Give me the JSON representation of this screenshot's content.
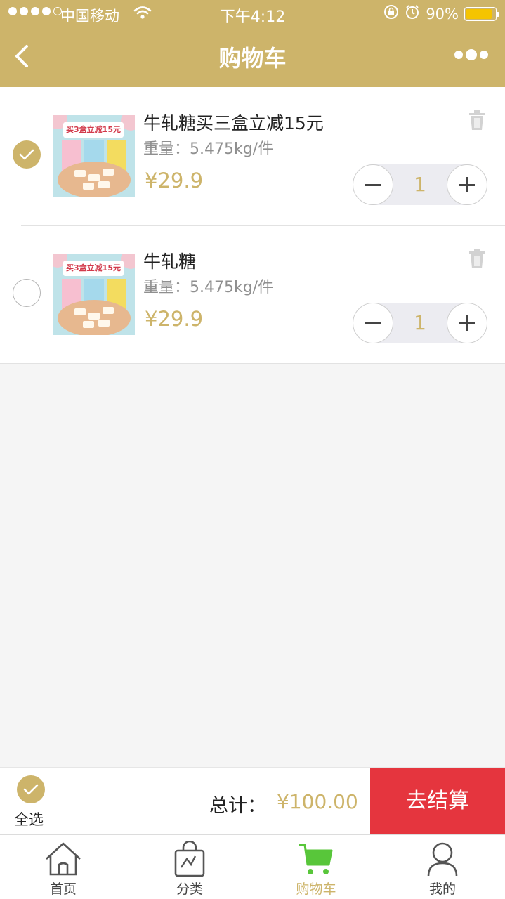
{
  "status_bar": {
    "carrier": "中国移动",
    "time": "下午4:12",
    "battery": "90%",
    "battery_level": 0.9
  },
  "nav": {
    "title": "购物车"
  },
  "items": [
    {
      "name": "牛轧糖买三盒立减15元",
      "weight": "重量：5.475kg/件",
      "price": "¥29.9",
      "quantity": "1",
      "checked": true,
      "thumb_banner": "买3盒立减15元"
    },
    {
      "name": "牛轧糖",
      "weight": "重量：5.475kg/件",
      "price": "¥29.9",
      "quantity": "1",
      "checked": false,
      "thumb_banner": "买3盒立减15元"
    }
  ],
  "checkout": {
    "select_all_label": "全选",
    "total_label": "总计：",
    "total_value": "¥100.00",
    "checkout_button": "去结算"
  },
  "tabbar": {
    "tabs": [
      {
        "label": "首页",
        "icon": "home-icon"
      },
      {
        "label": "分类",
        "icon": "shopping-bag-icon"
      },
      {
        "label": "购物车",
        "icon": "cart-icon",
        "active": true
      },
      {
        "label": "我的",
        "icon": "user-icon"
      }
    ]
  },
  "colors": {
    "accent": "#cdb46a",
    "checkout_button": "#e5353e",
    "cart_icon_active": "#58c63a"
  }
}
